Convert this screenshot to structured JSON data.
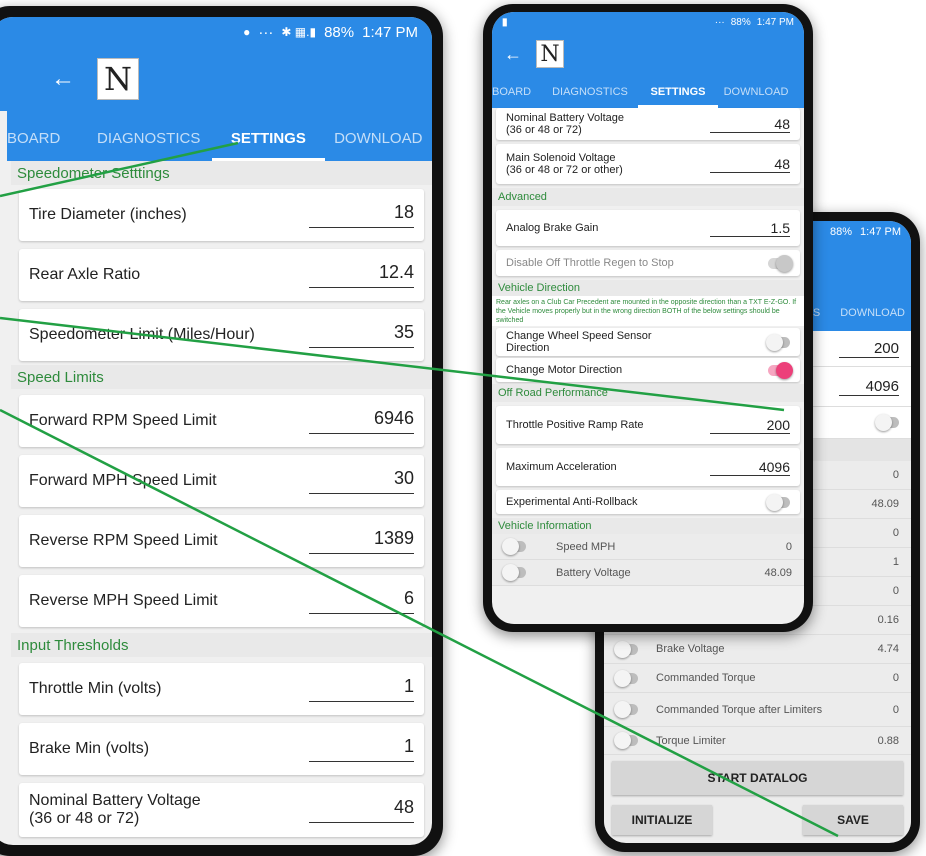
{
  "status": {
    "time": "1:47 PM",
    "battery": "88%",
    "dots": "···",
    "signal": "✱ ▦.▮"
  },
  "tabs": {
    "board": "BOARD",
    "diagnostics": "DIAGNOSTICS",
    "settings": "SETTINGS",
    "download": "DOWNLOAD",
    "partial": "S"
  },
  "logo": "N",
  "left": {
    "speedo_section": "Speedometer Setttings",
    "tire_label": "Tire Diameter (inches)",
    "tire_value": "18",
    "axle_label": "Rear Axle Ratio",
    "axle_value": "12.4",
    "speedo_label": "Speedometer Limit (Miles/Hour)",
    "speedo_value": "35",
    "limits_section": "Speed Limits",
    "fwd_rpm_label": "Forward RPM Speed Limit",
    "fwd_rpm_value": "6946",
    "fwd_mph_label": "Forward MPH Speed Limit",
    "fwd_mph_value": "30",
    "rev_rpm_label": "Reverse RPM Speed Limit",
    "rev_rpm_value": "1389",
    "rev_mph_label": "Reverse MPH Speed Limit",
    "rev_mph_value": "6",
    "input_section": "Input Thresholds",
    "throttle_label": "Throttle Min (volts)",
    "throttle_value": "1",
    "brake_label": "Brake Min (volts)",
    "brake_value": "1",
    "nbv_label": "Nominal Battery Voltage",
    "nbv_sub": "(36 or 48 or 72)",
    "nbv_value": "48"
  },
  "middle": {
    "nbv_label": "Nominal Battery Voltage",
    "nbv_sub": "(36 or 48 or 72)",
    "nbv_value": "48",
    "msv_label": "Main Solenoid Voltage",
    "msv_sub": "(36 or 48 or 72 or other)",
    "msv_value": "48",
    "advanced_section": "Advanced",
    "brake_gain_label": "Analog Brake Gain",
    "brake_gain_value": "1.5",
    "regen_label": "Disable Off Throttle Regen to Stop",
    "direction_section": "Vehicle Direction",
    "direction_note": "Rear axles on a Club Car Precedent are mounted in the opposite direction than a TXT E-Z-GO. If the Vehicle moves properly but in the wrong direction BOTH of the below settings should be switched",
    "wheel_label": "Change Wheel Speed Sensor Direction",
    "motor_label": "Change Motor Direction",
    "offroad_section": "Off Road Performance",
    "ramp_label": "Throttle Positive Ramp Rate",
    "ramp_value": "200",
    "accel_label": "Maximum Acceleration",
    "accel_value": "4096",
    "rollback_label": "Experimental Anti-Rollback",
    "info_section": "Vehicle Information",
    "speed_mph_label": "Speed MPH",
    "speed_mph_value": "0",
    "battery_label": "Battery Voltage",
    "battery_value": "48.09"
  },
  "right": {
    "ramp_value": "200",
    "accel_value": "4096",
    "values": [
      "0",
      "48.09",
      "0",
      "1",
      "0",
      "0.16"
    ],
    "brake_voltage_label": "Brake Voltage",
    "brake_voltage_value": "4.74",
    "cmd_torque_label": "Commanded Torque",
    "cmd_torque_value": "0",
    "cmd_after_label": "Commanded Torque after Limiters",
    "cmd_after_value": "0",
    "torque_limiter_label": "Torque Limiter",
    "torque_limiter_value": "0.88",
    "start_datalog": "START DATALOG",
    "initialize": "INITIALIZE",
    "save": "SAVE"
  },
  "colors": {
    "primary": "#2b8ae6",
    "section_text": "#2e8b3c",
    "pointer_line": "#22a044",
    "toggle_on": "#ec407a"
  },
  "icons": {
    "back": "←",
    "status_app": "●"
  }
}
